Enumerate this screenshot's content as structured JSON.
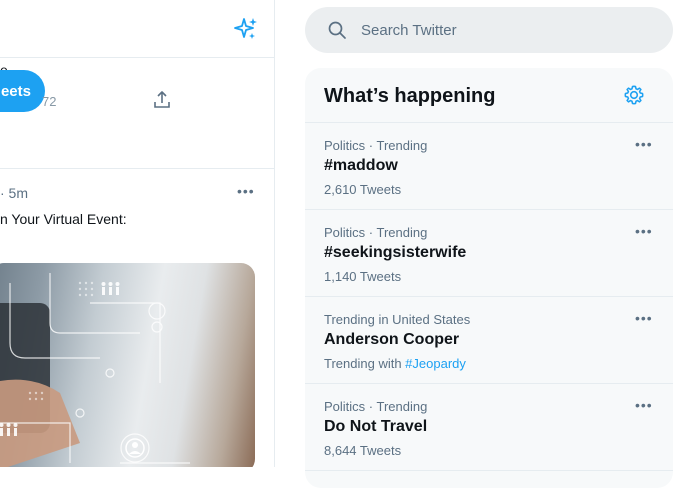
{
  "timeline": {
    "header_fragment": "e",
    "tweet_button_label": "eets",
    "retweet_count_fragment": "72",
    "tweet_meta": "· 5m",
    "tweet_more": "•••",
    "tweet_text": "n Your Virtual Event:"
  },
  "search": {
    "placeholder": "Search Twitter"
  },
  "trends": {
    "title": "What’s happening",
    "items": [
      {
        "context": "Politics · Trending",
        "name": "#maddow",
        "sub": "2,610 Tweets",
        "more": "•••"
      },
      {
        "context": "Politics · Trending",
        "name": "#seekingsisterwife",
        "sub": "1,140 Tweets",
        "more": "•••"
      },
      {
        "context": "Trending in United States",
        "name": "Anderson Cooper",
        "sub_prefix": "Trending with ",
        "sub_link": "#Jeopardy",
        "more": "•••"
      },
      {
        "context": "Politics · Trending",
        "name": "Do Not Travel",
        "sub": "8,644 Tweets",
        "more": "•••"
      }
    ]
  },
  "colors": {
    "accent": "#1da1f2",
    "secondary_text": "#5b7083",
    "panel_bg": "#f7f9fa",
    "search_bg": "#ebeef0"
  }
}
